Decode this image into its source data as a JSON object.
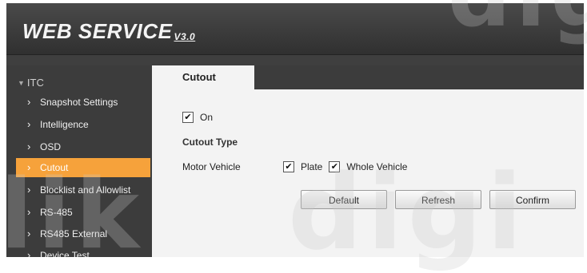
{
  "app": {
    "brand": "WEB SERVICE",
    "version": "V3.0"
  },
  "sidebar": {
    "group": "ITC",
    "items": [
      {
        "label": "Snapshot Settings",
        "active": false
      },
      {
        "label": "Intelligence",
        "active": false
      },
      {
        "label": "OSD",
        "active": false
      },
      {
        "label": "Cutout",
        "active": true
      },
      {
        "label": "Blocklist and Allowlist",
        "active": false
      },
      {
        "label": "RS-485",
        "active": false
      },
      {
        "label": "RS485 External",
        "active": false
      },
      {
        "label": "Device Test",
        "active": false
      }
    ]
  },
  "main": {
    "tab": "Cutout",
    "enable": {
      "label": "On",
      "checked": true
    },
    "cutout_type_label": "Cutout Type",
    "motor_vehicle": {
      "label": "Motor Vehicle",
      "plate": {
        "label": "Plate",
        "checked": true
      },
      "whole_vehicle": {
        "label": "Whole Vehicle",
        "checked": true
      }
    },
    "buttons": {
      "default": "Default",
      "refresh": "Refresh",
      "confirm": "Confirm"
    }
  },
  "colors": {
    "accent": "#f6a23b",
    "sidebar_bg": "#3c3c3c",
    "content_bg": "#f3f3f3"
  }
}
